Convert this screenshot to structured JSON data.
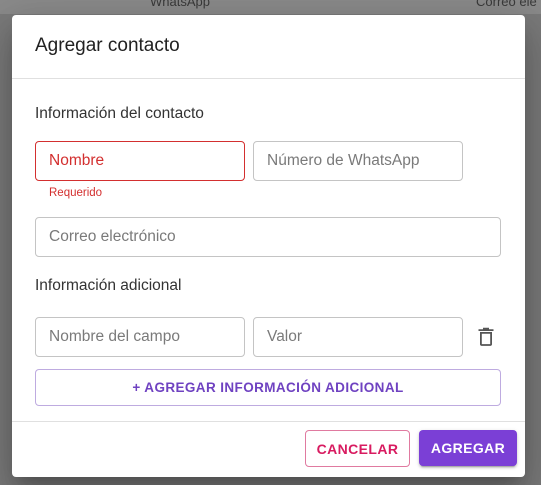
{
  "background": {
    "header_col_whatsapp": "WhatsApp",
    "header_col_email": "Correo ele"
  },
  "dialog": {
    "title": "Agregar contacto",
    "contact_section": {
      "title": "Información del contacto",
      "name_placeholder": "Nombre",
      "name_value": "",
      "name_error": "Requerido",
      "whatsapp_placeholder": "Número de WhatsApp",
      "whatsapp_value": "",
      "email_placeholder": "Correo electrónico",
      "email_value": ""
    },
    "extra_section": {
      "title": "Información adicional",
      "field_name_placeholder": "Nombre del campo",
      "field_value_placeholder": "Valor",
      "add_button_label": "+ AGREGAR INFORMACIÓN ADICIONAL"
    },
    "actions": {
      "cancel_label": "CANCELAR",
      "add_label": "AGREGAR"
    }
  },
  "colors": {
    "primary": "#7b3fd6",
    "secondary": "#d81b60",
    "error": "#d32f2f"
  },
  "icons": {
    "delete": "trash-icon"
  }
}
